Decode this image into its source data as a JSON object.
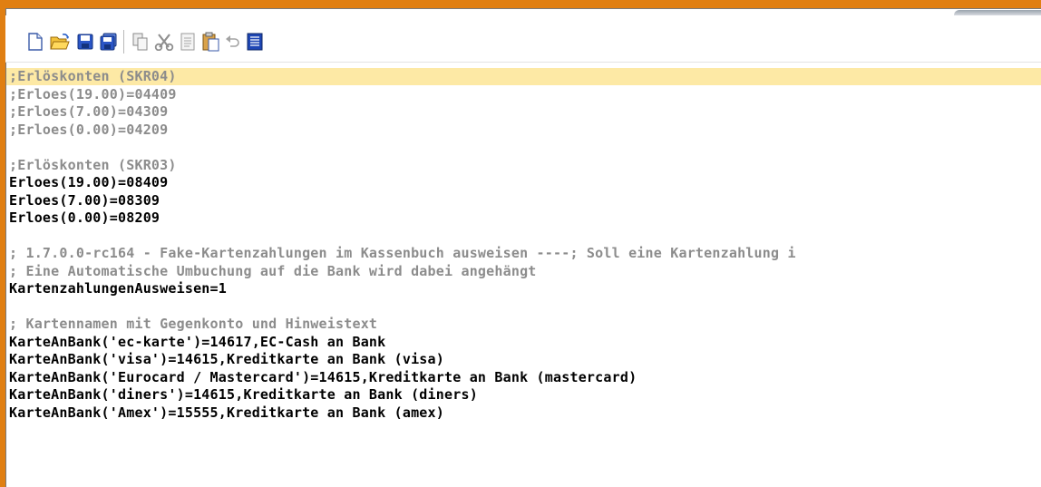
{
  "colors": {
    "frame": "#e07f12",
    "current_line": "#fde9a5",
    "comment_text": "#8c8c8c",
    "code_text": "#000000"
  },
  "toolbar": {
    "buttons": [
      {
        "name": "new-document-icon",
        "icon": "new-document"
      },
      {
        "name": "open-folder-icon",
        "icon": "open-folder"
      },
      {
        "name": "save-icon",
        "icon": "floppy-disk"
      },
      {
        "name": "save-all-icon",
        "icon": "floppy-disk-stack"
      },
      {
        "name": "copy-icon",
        "icon": "copy"
      },
      {
        "name": "cut-icon",
        "icon": "scissors"
      },
      {
        "name": "paste-icon",
        "icon": "paste-document"
      },
      {
        "name": "paste-special-icon",
        "icon": "clipboard"
      },
      {
        "name": "undo-icon",
        "icon": "undo-arrow"
      },
      {
        "name": "select-all-icon",
        "icon": "select-all"
      }
    ]
  },
  "editor": {
    "lines": [
      {
        "text": ";Erlöskonten (SKR04)",
        "kind": "comment",
        "current": true
      },
      {
        "text": ";Erloes(19.00)=04409",
        "kind": "comment"
      },
      {
        "text": ";Erloes(7.00)=04309",
        "kind": "comment"
      },
      {
        "text": ";Erloes(0.00)=04209",
        "kind": "comment"
      },
      {
        "text": "",
        "kind": "blank"
      },
      {
        "text": ";Erlöskonten (SKR03)",
        "kind": "comment"
      },
      {
        "text": "Erloes(19.00)=08409",
        "kind": "code"
      },
      {
        "text": "Erloes(7.00)=08309",
        "kind": "code"
      },
      {
        "text": "Erloes(0.00)=08209",
        "kind": "code"
      },
      {
        "text": "",
        "kind": "blank"
      },
      {
        "text": "; 1.7.0.0-rc164 - Fake-Kartenzahlungen im Kassenbuch ausweisen ----; Soll eine Kartenzahlung i",
        "kind": "comment"
      },
      {
        "text": "; Eine Automatische Umbuchung auf die Bank wird dabei angehängt",
        "kind": "comment"
      },
      {
        "text": "KartenzahlungenAusweisen=1",
        "kind": "code"
      },
      {
        "text": "",
        "kind": "blank"
      },
      {
        "text": "; Kartennamen mit Gegenkonto und Hinweistext",
        "kind": "comment"
      },
      {
        "text": "KarteAnBank('ec-karte')=14617,EC-Cash an Bank",
        "kind": "code"
      },
      {
        "text": "KarteAnBank('visa')=14615,Kreditkarte an Bank (visa)",
        "kind": "code"
      },
      {
        "text": "KarteAnBank('Eurocard / Mastercard')=14615,Kreditkarte an Bank (mastercard)",
        "kind": "code"
      },
      {
        "text": "KarteAnBank('diners')=14615,Kreditkarte an Bank (diners)",
        "kind": "code"
      },
      {
        "text": "KarteAnBank('Amex')=15555,Kreditkarte an Bank (amex)",
        "kind": "code"
      }
    ]
  }
}
